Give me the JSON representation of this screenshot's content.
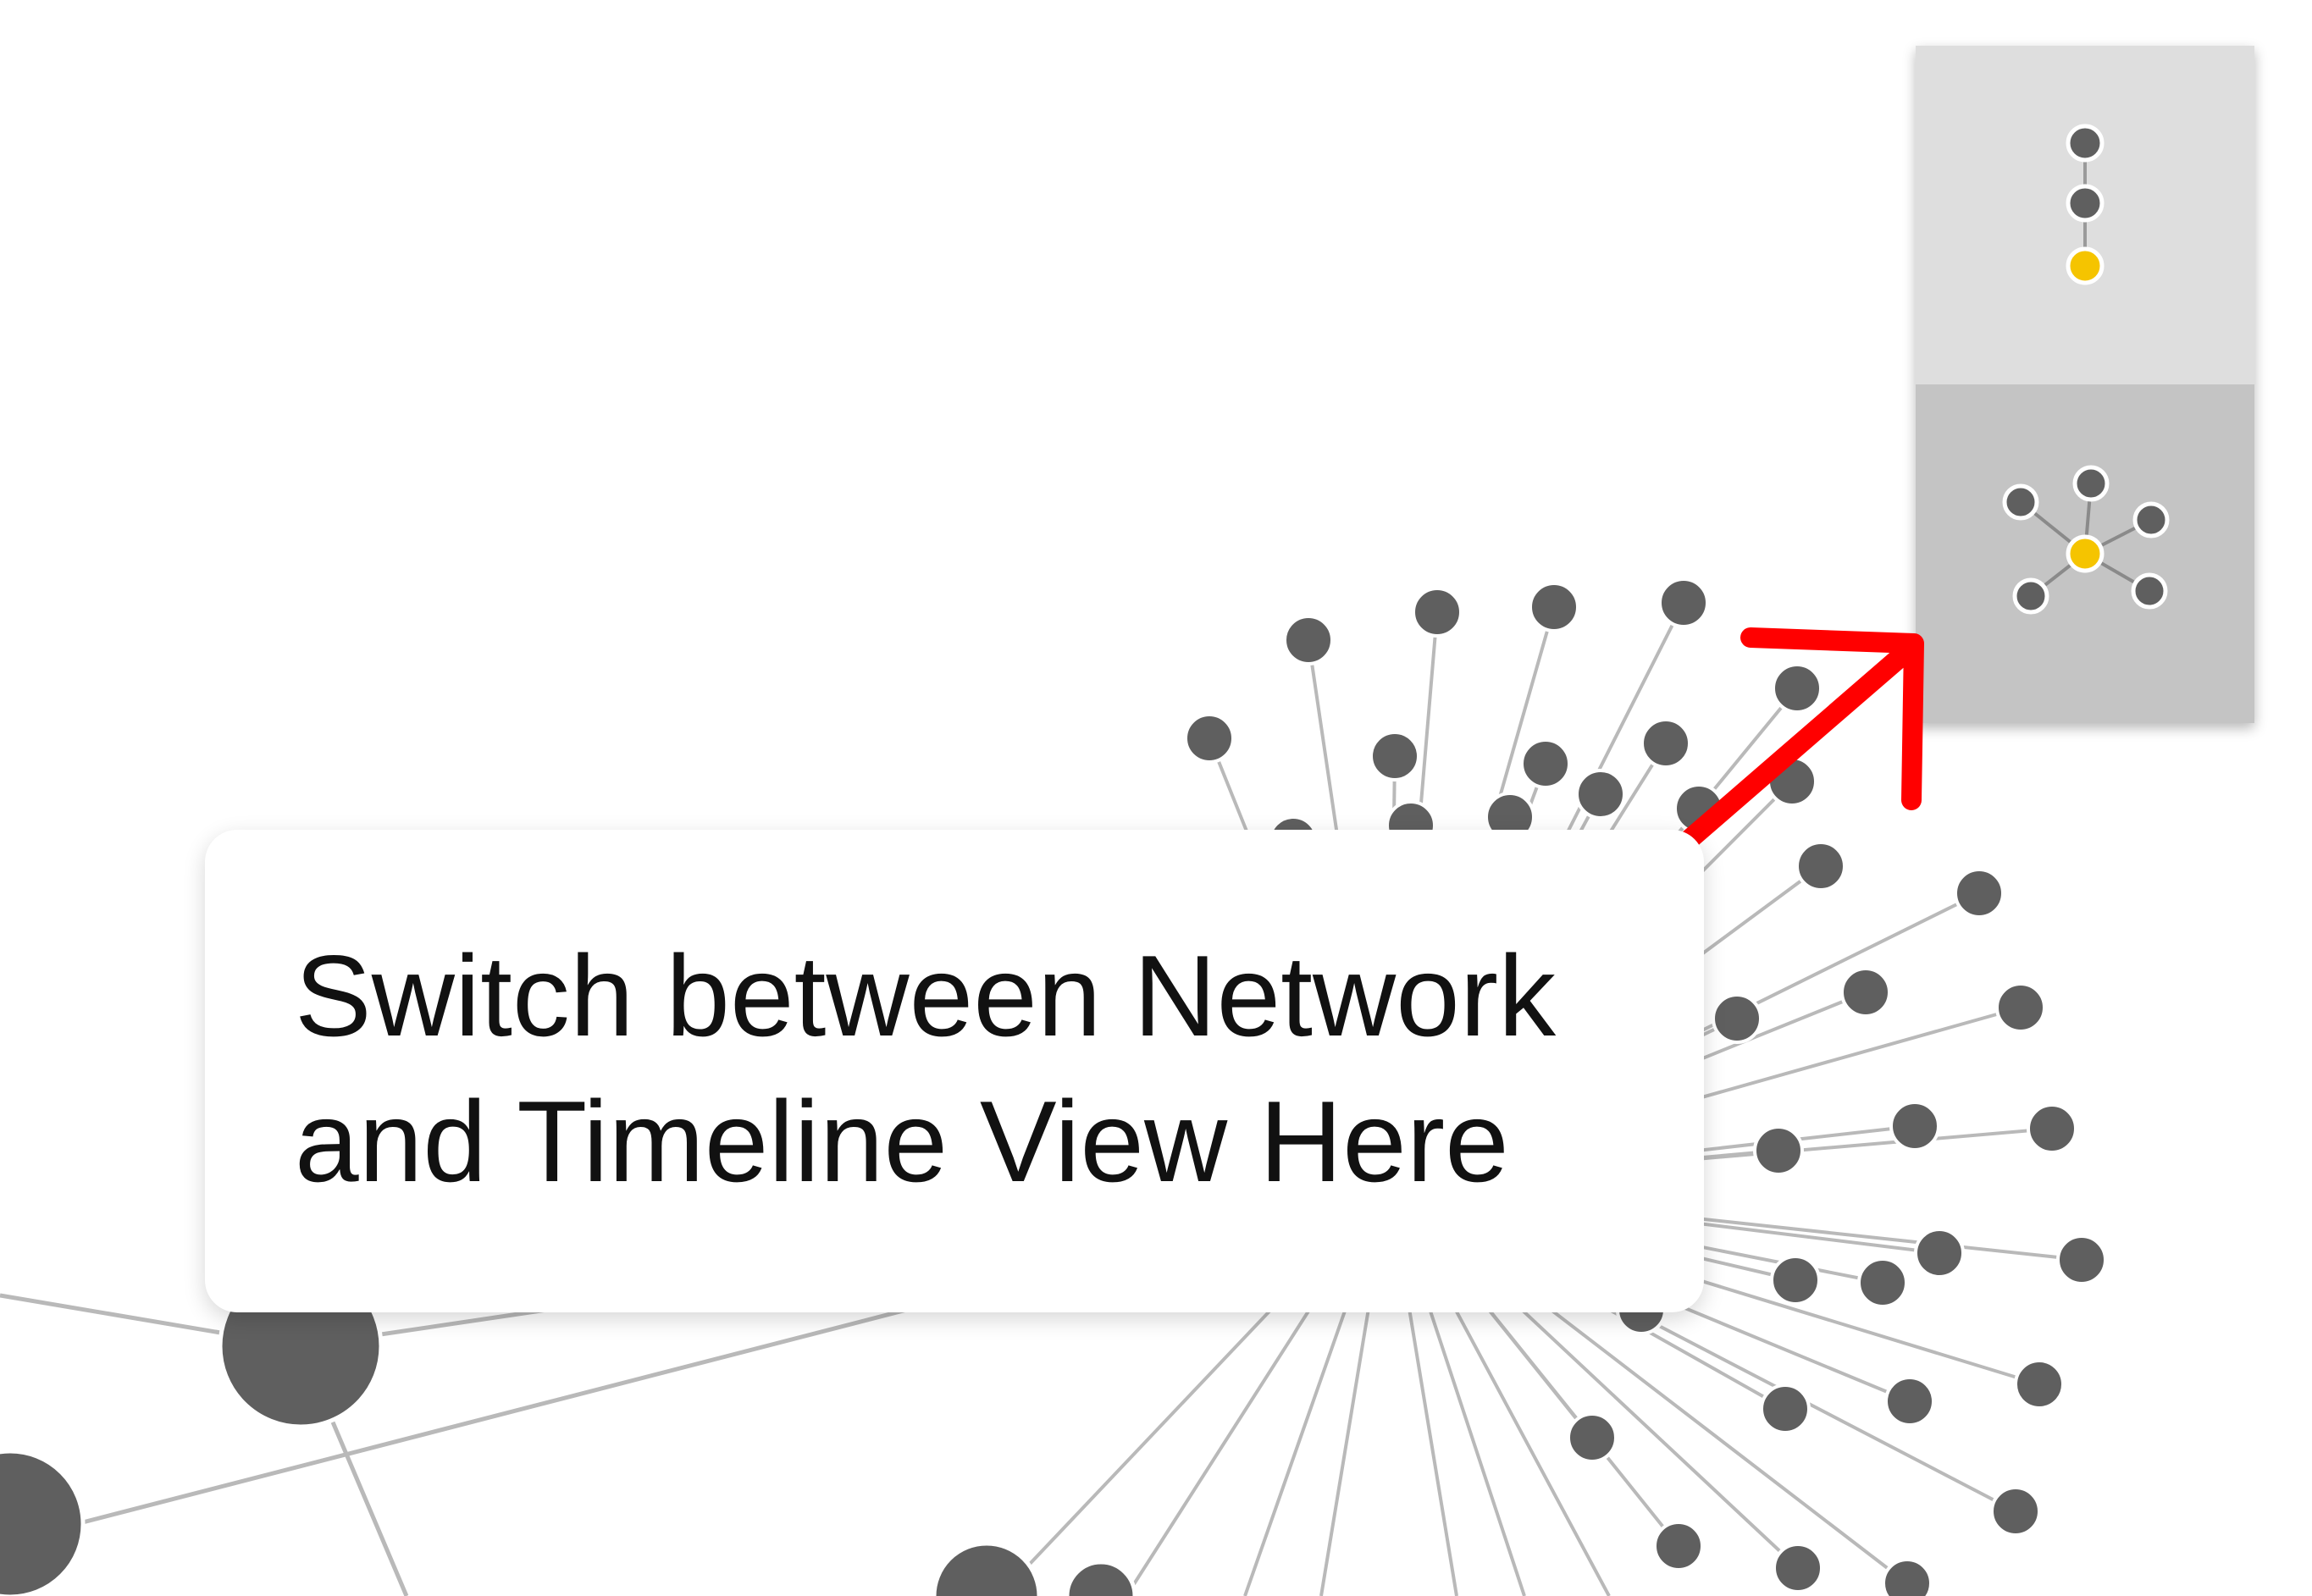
{
  "callout": {
    "line1": "Switch between Network",
    "line2": "and Timeline View Here"
  },
  "view_switcher": {
    "timeline_label": "Timeline View",
    "network_label": "Network View"
  },
  "colors": {
    "node": "#5f5f5f",
    "edge": "#b9b9b9",
    "highlight_node": "#f5c400",
    "arrow": "#ff0000",
    "switcher_top": "#dedede",
    "switcher_bottom": "#c4c4c4"
  },
  "icons": {
    "timeline": "timeline-view-icon",
    "network": "network-view-icon",
    "arrow": "red-arrow-icon"
  }
}
